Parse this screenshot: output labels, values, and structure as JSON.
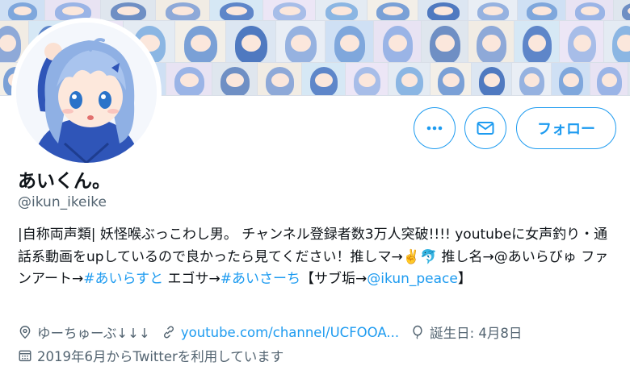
{
  "profile": {
    "display_name": "あいくん。",
    "handle": "@ikun_ikeike"
  },
  "actions": {
    "more_icon": "more-horizontal-icon",
    "message_icon": "envelope-icon",
    "follow_label": "フォロー"
  },
  "bio": {
    "part1": "|自称両声類| 妖怪喉ぶっこわし男。 チャンネル登録者数3万人突破!!!! youtubeに女声釣り・通話系動画をupしているので良かったら見てください！推しマ→",
    "emoji1": "✌️",
    "emoji2": "🐬",
    "part2": " 推し名→@あいらびゅ ファンアート→",
    "hashtag1": "#あいらすと",
    "part3": " エゴサ→",
    "hashtag2": "#あいさーち",
    "part4": "【サブ垢→",
    "mention": "@ikun_peace",
    "part5": "】"
  },
  "meta": {
    "location": "ゆーちゅーぶ↓↓↓",
    "website": "youtube.com/channel/UCFOOA...",
    "birthday": "誕生日: 4月8日",
    "joined": "2019年6月からTwitterを利用しています"
  },
  "colors": {
    "accent": "#1d9bf0",
    "secondary_text": "#536471",
    "primary_text": "#0f1419"
  }
}
